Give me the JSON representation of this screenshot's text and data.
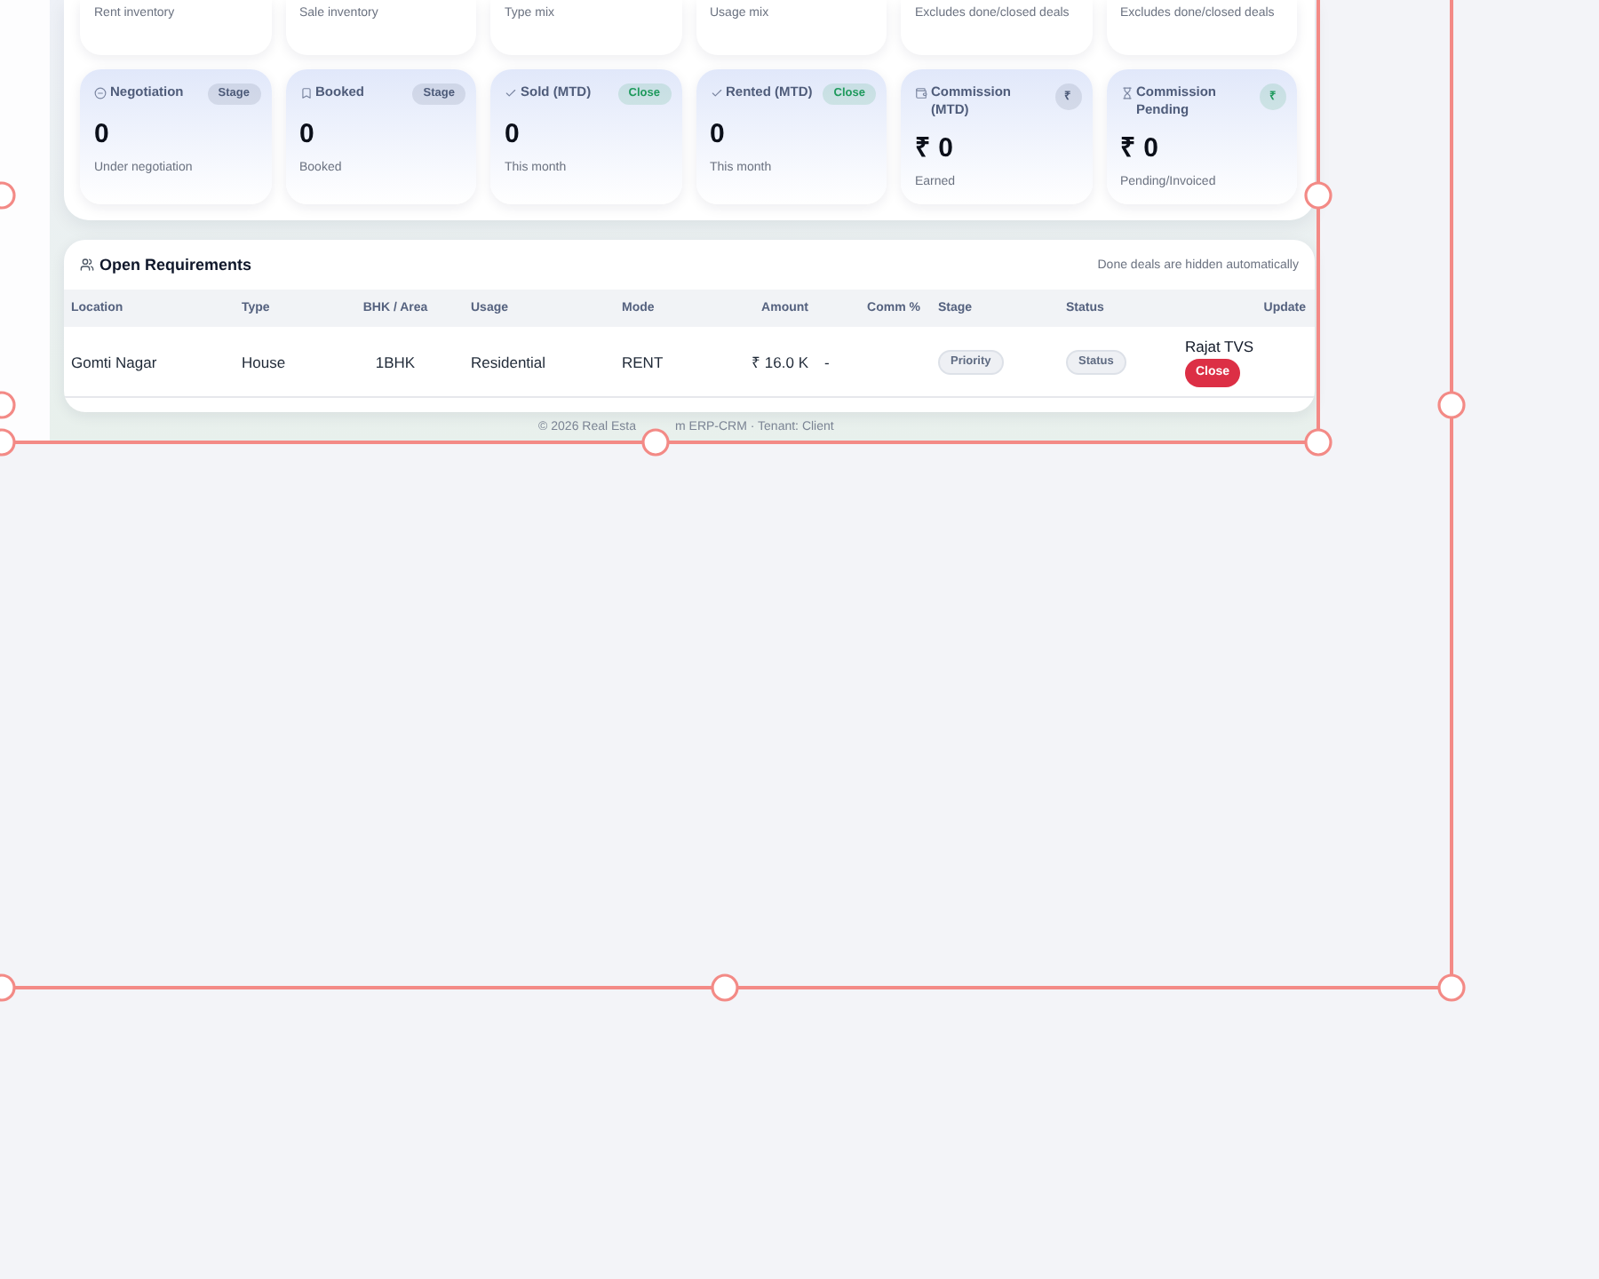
{
  "summary_cards": [
    {
      "description": "Rent inventory"
    },
    {
      "description": "Sale inventory"
    },
    {
      "description": "Type mix"
    },
    {
      "description": "Usage mix"
    },
    {
      "description": "Excludes done/closed deals"
    },
    {
      "description": "Excludes done/closed deals"
    }
  ],
  "stage_cards": [
    {
      "title": "Negotiation",
      "badge": {
        "text": "Stage",
        "color": "#4c5a78",
        "kind": "pill"
      },
      "value": "0",
      "description": "Under negotiation"
    },
    {
      "title": "Booked",
      "badge": {
        "text": "Stage",
        "color": "#4c5a78",
        "kind": "pill"
      },
      "value": "0",
      "description": "Booked"
    },
    {
      "title": "Sold (MTD)",
      "badge": {
        "text": "Close",
        "color": "#1f9a5d",
        "kind": "pill"
      },
      "value": "0",
      "description": "This month"
    },
    {
      "title": "Rented (MTD)",
      "badge": {
        "text": "Close",
        "color": "#1f9a5d",
        "kind": "pill"
      },
      "value": "0",
      "description": "This month"
    },
    {
      "title": "Commission (MTD)",
      "badge": {
        "text": "₹",
        "color": "#4c5a78",
        "kind": "circle"
      },
      "value": "₹ 0",
      "description": "Earned"
    },
    {
      "title": "Commission Pending",
      "badge": {
        "text": "₹",
        "color": "#1f9a5d",
        "kind": "circle"
      },
      "value": "₹ 0",
      "description": "Pending/Invoiced"
    }
  ],
  "requirements": {
    "title": "Open Requirements",
    "note": "Done deals are hidden automatically",
    "columns": [
      "Location",
      "Type",
      "BHK / Area",
      "Usage",
      "Mode",
      "Amount",
      "Comm %",
      "Stage",
      "Status",
      "Update"
    ],
    "rows": [
      {
        "location": "Gomti Nagar",
        "type": "House",
        "bhk_area": "1BHK",
        "usage": "Residential",
        "mode": "RENT",
        "amount": "₹ 16.0 K",
        "comm_pct": "-",
        "stage": "Priority",
        "status": "Status",
        "assignee": "Rajat TVS",
        "action": "Close"
      }
    ]
  },
  "footer": {
    "text_parts": [
      "© 2026 Real Esta",
      "m ERP-CRM · Tenant: Client"
    ]
  }
}
